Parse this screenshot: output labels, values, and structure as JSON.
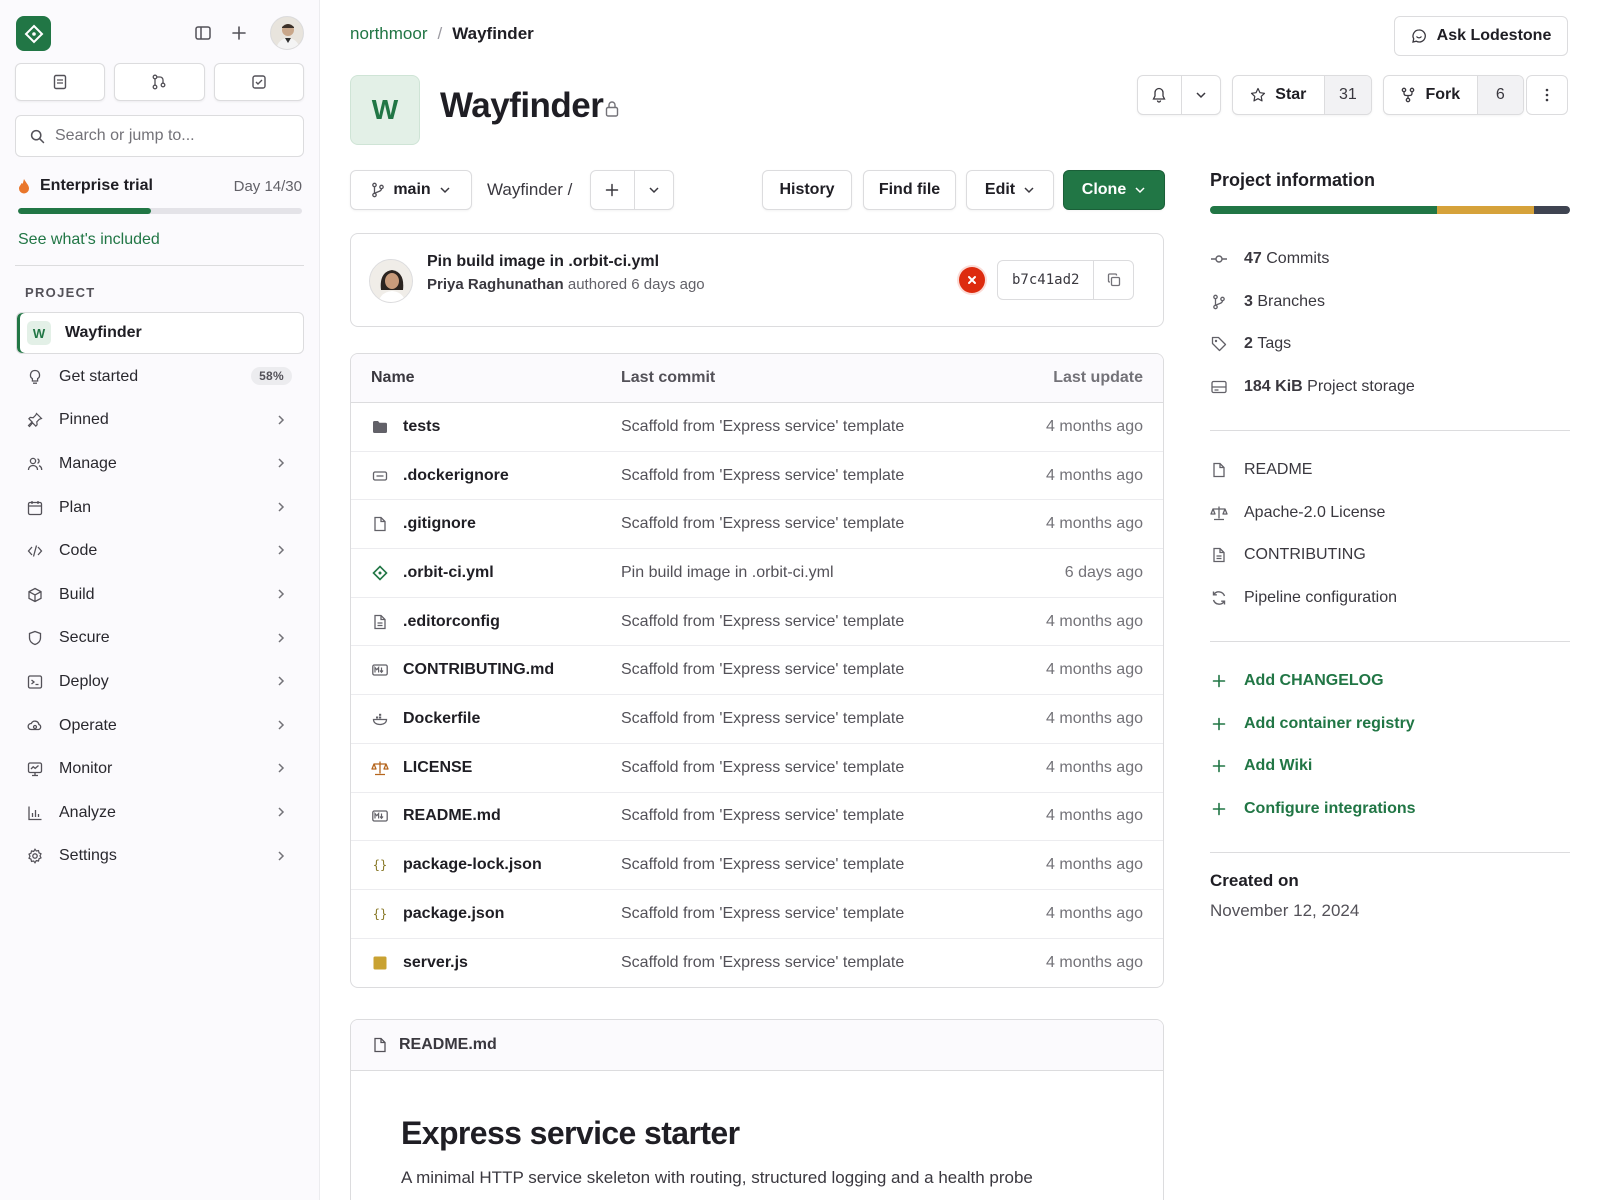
{
  "colors": {
    "accent": "#217645",
    "danger": "#dd2b0e"
  },
  "sidebar": {
    "search_placeholder": "Search or jump to...",
    "trial": {
      "title": "Enterprise trial",
      "day": "Day 14/30",
      "progress": 0.47,
      "link": "See what's included"
    },
    "section_label": "PROJECT",
    "project": {
      "initial": "W",
      "name": "Wayfinder"
    },
    "items": [
      {
        "label": "Get started",
        "icon": "lightbulb-icon",
        "badge": "58%"
      },
      {
        "label": "Pinned",
        "icon": "pin-icon"
      },
      {
        "label": "Manage",
        "icon": "users-icon"
      },
      {
        "label": "Plan",
        "icon": "calendar-icon"
      },
      {
        "label": "Code",
        "icon": "code-icon"
      },
      {
        "label": "Build",
        "icon": "cube-icon"
      },
      {
        "label": "Secure",
        "icon": "shield-icon"
      },
      {
        "label": "Deploy",
        "icon": "terminal-icon"
      },
      {
        "label": "Operate",
        "icon": "cloud-gear-icon"
      },
      {
        "label": "Monitor",
        "icon": "monitor-icon"
      },
      {
        "label": "Analyze",
        "icon": "chart-icon"
      },
      {
        "label": "Settings",
        "icon": "gear-icon"
      }
    ]
  },
  "breadcrumb": {
    "group": "northmoor",
    "separator": "/",
    "project": "Wayfinder"
  },
  "header": {
    "ask_label": "Ask Lodestone",
    "avatar_initial": "W",
    "title": "Wayfinder",
    "star_label": "Star",
    "star_count": "31",
    "fork_label": "Fork",
    "fork_count": "6"
  },
  "toolbar": {
    "branch": "main",
    "path": "Wayfinder /",
    "history": "History",
    "find_file": "Find file",
    "edit": "Edit",
    "clone": "Clone"
  },
  "last_commit": {
    "message": "Pin build image in .orbit-ci.yml",
    "author": "Priya Raghunathan",
    "meta": "authored 6 days ago",
    "sha": "b7c41ad2"
  },
  "files": {
    "headers": {
      "name": "Name",
      "commit": "Last commit",
      "updated": "Last update"
    },
    "rows": [
      {
        "name": "tests",
        "icon": "folder-icon",
        "commit": "Scaffold from 'Express service' template",
        "updated": "4 months ago"
      },
      {
        "name": ".dockerignore",
        "icon": "file-ignore-icon",
        "commit": "Scaffold from 'Express service' template",
        "updated": "4 months ago"
      },
      {
        "name": ".gitignore",
        "icon": "file-icon",
        "commit": "Scaffold from 'Express service' template",
        "updated": "4 months ago"
      },
      {
        "name": ".orbit-ci.yml",
        "icon": "ci-icon",
        "commit": "Pin build image in .orbit-ci.yml",
        "updated": "6 days ago"
      },
      {
        "name": ".editorconfig",
        "icon": "file-text-icon",
        "commit": "Scaffold from 'Express service' template",
        "updated": "4 months ago"
      },
      {
        "name": "CONTRIBUTING.md",
        "icon": "markdown-icon",
        "commit": "Scaffold from 'Express service' template",
        "updated": "4 months ago"
      },
      {
        "name": "Dockerfile",
        "icon": "docker-icon",
        "commit": "Scaffold from 'Express service' template",
        "updated": "4 months ago"
      },
      {
        "name": "LICENSE",
        "icon": "scale-icon",
        "commit": "Scaffold from 'Express service' template",
        "updated": "4 months ago"
      },
      {
        "name": "README.md",
        "icon": "markdown-icon",
        "commit": "Scaffold from 'Express service' template",
        "updated": "4 months ago"
      },
      {
        "name": "package-lock.json",
        "icon": "json-icon",
        "commit": "Scaffold from 'Express service' template",
        "updated": "4 months ago"
      },
      {
        "name": "package.json",
        "icon": "json-icon",
        "commit": "Scaffold from 'Express service' template",
        "updated": "4 months ago"
      },
      {
        "name": "server.js",
        "icon": "js-icon",
        "commit": "Scaffold from 'Express service' template",
        "updated": "4 months ago"
      }
    ]
  },
  "readme": {
    "filename": "README.md",
    "heading": "Express service starter",
    "intro": "A minimal HTTP service skeleton with routing, structured logging and a health probe"
  },
  "project_info": {
    "title": "Project information",
    "languages": [
      {
        "share": 0.63,
        "color": "#217645"
      },
      {
        "share": 0.27,
        "color": "#d6a23a"
      },
      {
        "share": 0.1,
        "color": "#3f4451"
      }
    ],
    "stats": [
      {
        "value": "47",
        "label": "Commits",
        "icon": "commit-icon"
      },
      {
        "value": "3",
        "label": "Branches",
        "icon": "branch-icon"
      },
      {
        "value": "2",
        "label": "Tags",
        "icon": "tag-icon"
      },
      {
        "value": "184 KiB",
        "label": "Project storage",
        "icon": "storage-icon"
      }
    ],
    "links": [
      {
        "label": "README",
        "icon": "file-icon"
      },
      {
        "label": "Apache-2.0 License",
        "icon": "scale-icon"
      },
      {
        "label": "CONTRIBUTING",
        "icon": "file-text-icon"
      },
      {
        "label": "Pipeline configuration",
        "icon": "pipeline-icon"
      }
    ],
    "add_links": [
      {
        "label": "Add CHANGELOG"
      },
      {
        "label": "Add container registry"
      },
      {
        "label": "Add Wiki"
      },
      {
        "label": "Configure integrations"
      }
    ],
    "created_label": "Created on",
    "created_date": "November 12, 2024"
  }
}
